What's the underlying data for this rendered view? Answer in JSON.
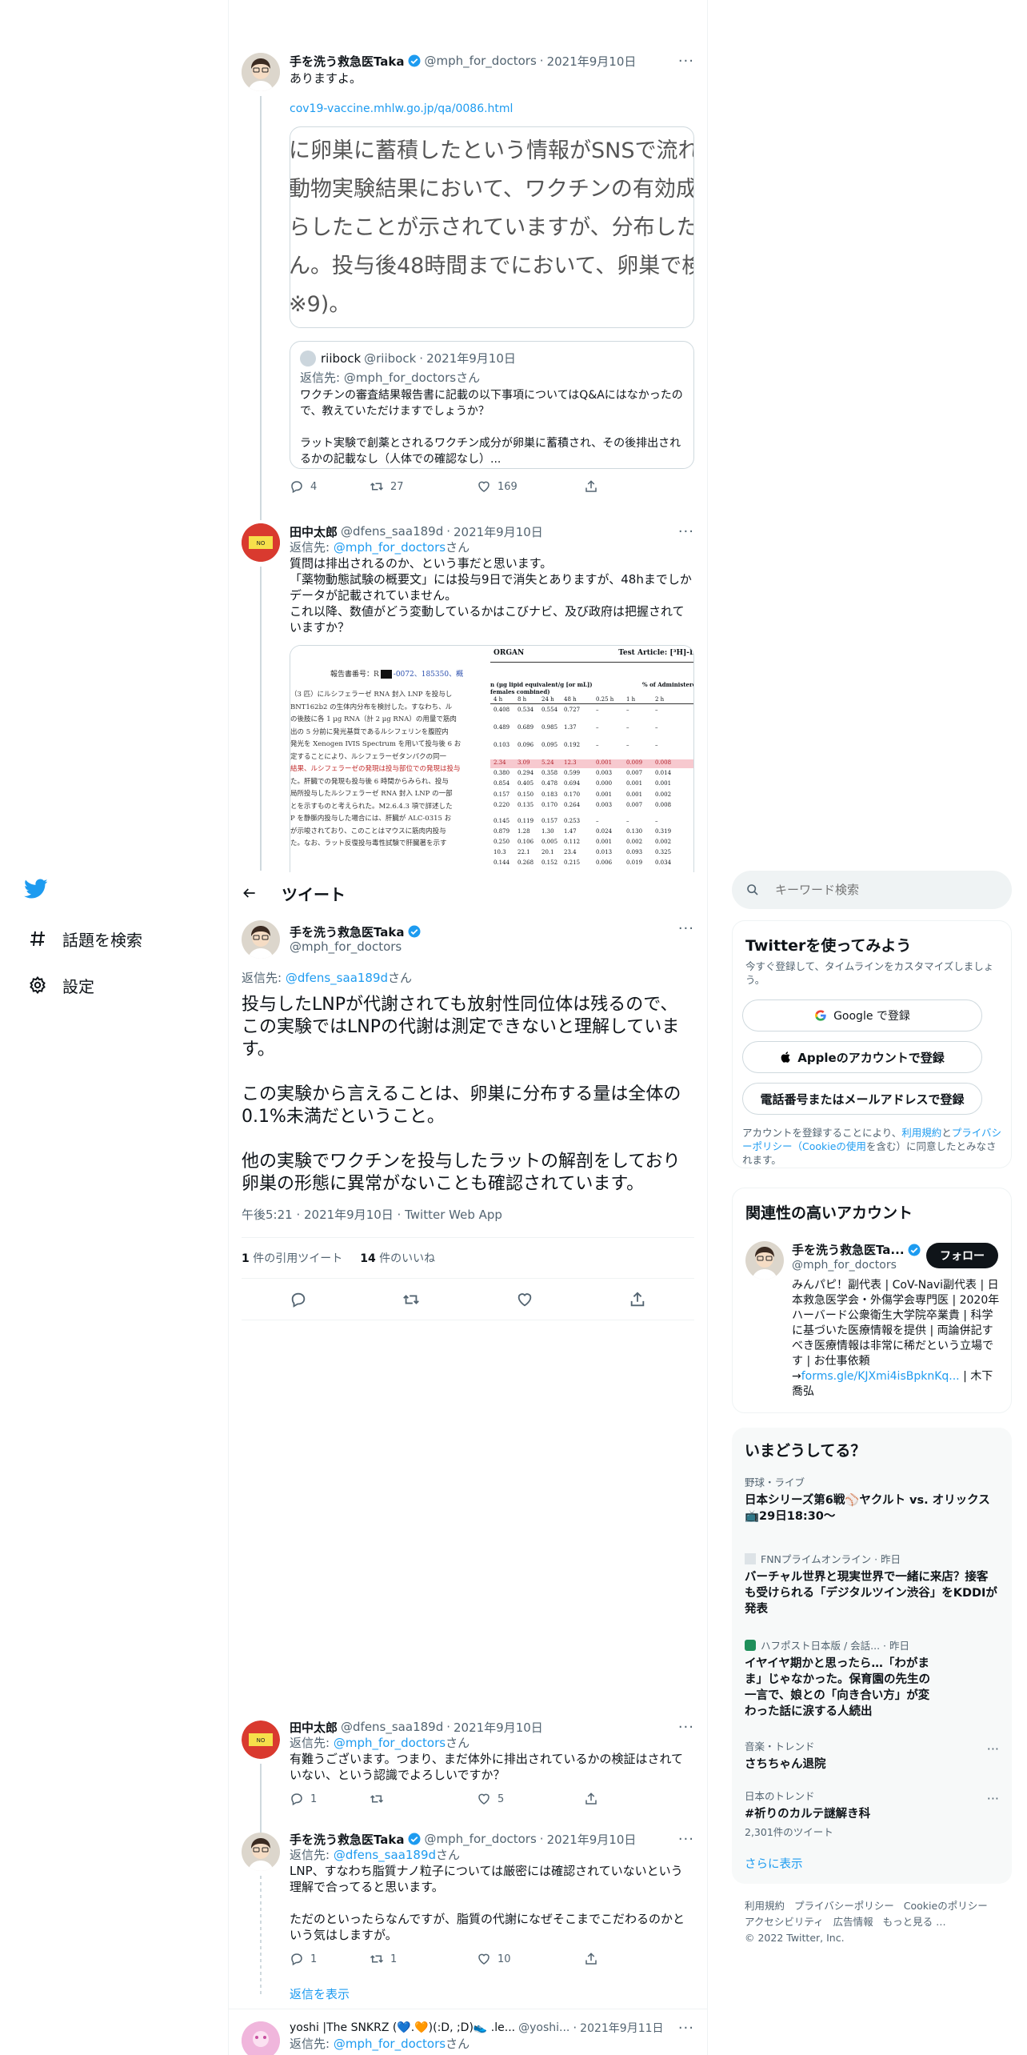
{
  "nav": {
    "explore": "話題を検索",
    "settings": "設定"
  },
  "header": {
    "title": "ツイート"
  },
  "tweet1": {
    "name": "手を洗う救急医Taka",
    "handle": "@mph_for_doctors",
    "dot": "·",
    "date": "2021年9月10日",
    "text": "ありますよ。",
    "link": "cov19-vaccine.mhlw.go.jp/qa/0086.html",
    "card_lines": [
      "に卵巣に蓄積したという情報がSNSで流れ",
      "動物実験結果において、ワクチンの有効成分",
      "らしたことが示されていますが、分布した量",
      "ん。投与後48時間までにおいて、卵巣で検出",
      "※9)。"
    ],
    "quote": {
      "name": "riibock",
      "handle": "@riibock",
      "dot": "·",
      "date": "2021年9月10日",
      "reply_prefix": "返信先: ",
      "reply_to": "@mph_for_doctors",
      "reply_suffix": "さん",
      "text": "ワクチンの審査結果報告書に記載の以下事項についてはQ&Aにはなかったので、教えていただけますでしょうか？\n\nラット実験で創薬とされるワクチン成分が卵巣に蓄積され、その後排出されるかの記載なし（人体での確認なし）..."
    },
    "replies": "4",
    "retweets": "27",
    "likes": "169"
  },
  "tweet2": {
    "name": "田中太郎",
    "handle": "@dfens_saa189d",
    "dot": "·",
    "date": "2021年9月10日",
    "reply_prefix": "返信先: ",
    "reply_to": "@mph_for_doctors",
    "reply_suffix": "さん",
    "text": "質問は排出されるのか、という事だと思います。\n「薬物動態試験の概要文」には投与9日で消失とありますが、48hまでしかデータが記載されていません。\nこれ以降、数値がどう変動しているかはこびナビ、及び政府は把握されていますか？",
    "image_left_header": "報告書番号：R",
    "image_left_header2": "-0072、185350、概",
    "image_left_lines": [
      "（3 匹）にルシフェラーゼ RNA 封入 LNP を投与し",
      "BNT162b2 の生体内分布を検討した。すなわち、ル",
      "の後肢に各 1 µg RNA（計 2 µg RNA）の用量で筋肉",
      "出の 5 分前に発光基質であるルシフェリンを腹腔内",
      "発光を Xenogen IVIS Spectrum を用いて投与後 6 お",
      "定することにより、ルシフェラーゼタンパクの同一",
      "結果、ルシフェラーゼの発現は投与部位での発現は投与",
      "た。肝臓での発現も投与後 6 時間からみられ、投与",
      "局所投与したルシフェラーゼ RNA 封入 LNP の一部",
      "とを示すものと考えられた。M2.6.4.3 項で詳述した",
      "P を静脈内投与した場合には、肝臓が ALC-0315 お",
      "が示唆されており、このことはマウスに筋肉内投与",
      "た。なお、ラット反復投与毒性試験で肝臓著を示す"
    ],
    "image_right_title": "ORGAN",
    "image_right_title2": "Test Article: [³H]-Labelled L",
    "image_right_sub": "n (µg lipid equivalent/g [or mL])",
    "image_right_sub2": "females combined)",
    "image_right_sub3": "% of Administered D",
    "image_right_cols": [
      "4 h",
      "8 h",
      "24 h",
      "48 h",
      "0.25 h",
      "1 h",
      "2 h"
    ],
    "image_right_rows": [
      [
        "0.408",
        "0.534",
        "0.554",
        "0.727",
        "–",
        "–",
        "–"
      ],
      [
        "0.489",
        "0.689",
        "0.985",
        "1.37",
        "–",
        "–",
        "–"
      ],
      [
        "0.103",
        "0.096",
        "0.095",
        "0.192",
        "–",
        "–",
        "–"
      ],
      [
        "2.34",
        "3.09",
        "5.24",
        "12.3",
        "0.001",
        "0.009",
        "0.008"
      ],
      [
        "0.380",
        "0.294",
        "0.358",
        "0.599",
        "0.003",
        "0.007",
        "0.014"
      ],
      [
        "0.854",
        "0.405",
        "0.478",
        "0.694",
        "0.000",
        "0.001",
        "0.001"
      ],
      [
        "0.157",
        "0.150",
        "0.183",
        "0.170",
        "0.001",
        "0.001",
        "0.002"
      ],
      [
        "0.220",
        "0.135",
        "0.170",
        "0.264",
        "0.003",
        "0.007",
        "0.008"
      ],
      [
        "0.145",
        "0.119",
        "0.157",
        "0.253",
        "–",
        "–",
        "–"
      ],
      [
        "0.879",
        "1.28",
        "1.30",
        "1.47",
        "0.024",
        "0.130",
        "0.319"
      ],
      [
        "0.250",
        "0.106",
        "0.005",
        "0.112",
        "0.001",
        "0.002",
        "0.002"
      ],
      [
        "10.3",
        "22.1",
        "20.1",
        "23.4",
        "0.013",
        "0.093",
        "0.325"
      ],
      [
        "0.144",
        "0.268",
        "0.152",
        "0.215",
        "0.006",
        "0.019",
        "0.034"
      ]
    ]
  },
  "main_tweet": {
    "name": "手を洗う救急医Taka",
    "handle": "@mph_for_doctors",
    "reply_prefix": "返信先: ",
    "reply_to": "@dfens_saa189d",
    "reply_suffix": "さん",
    "text": "投与したLNPが代謝されても放射性同位体は残るので、この実験ではLNPの代謝は測定できないと理解しています。\n\nこの実験から言えることは、卵巣に分布する量は全体の0.1%未満だということ。\n\n他の実験でワクチンを投与したラットの解剖をしており卵巣の形態に異常がないことも確認されています。",
    "time": "午後5:21 · 2021年9月10日 · Twitter Web App",
    "quote_count": "1",
    "quote_label": " 件の引用ツイート",
    "like_count": "14",
    "like_label": " 件のいいね"
  },
  "reply1": {
    "name": "田中太郎",
    "handle": "@dfens_saa189d",
    "dot": "·",
    "date": "2021年9月10日",
    "reply_prefix": "返信先: ",
    "reply_to": "@mph_for_doctors",
    "reply_suffix": "さん",
    "text": "有難うございます。つまり、まだ体外に排出されているかの検証はされていない、という認識でよろしいですか？",
    "replies": "1",
    "likes": "5"
  },
  "reply2": {
    "name": "手を洗う救急医Taka",
    "handle": "@mph_for_doctors",
    "dot": "·",
    "date": "2021年9月10日",
    "reply_prefix": "返信先: ",
    "reply_to": "@dfens_saa189d",
    "reply_suffix": "さん",
    "text": "LNP、すなわち脂質ナノ粒子については厳密には確認されていないという理解で合ってると思います。\n\nただのといったらなんですが、脂質の代謝になぜそこまでこだわるのかという気はしますが。",
    "replies": "1",
    "retweets": "1",
    "likes": "10"
  },
  "show_replies": "返信を表示",
  "reply3": {
    "name": "yoshi |The SNKRZ (💙.🧡)(:D, ;D)👟 .le...",
    "handle": "@yoshi...",
    "dot": "·",
    "date": "2021年9月11日",
    "reply_prefix": "返信先: ",
    "reply_to": "@mph_for_doctors",
    "reply_suffix": "さん"
  },
  "search": {
    "placeholder": "キーワード検索"
  },
  "signup": {
    "title": "Twitterを使ってみよう",
    "subtitle": "今すぐ登録して、タイムラインをカスタマイズしましょう。",
    "google": "Google で登録",
    "apple": "Appleのアカウントで登録",
    "phone": "電話番号またはメールアドレスで登録",
    "terms_pre": "アカウントを登録することにより、",
    "terms_link1": "利用規約",
    "terms_mid": "と",
    "terms_link2": "プライバシーポリシー（Cookieの使用",
    "terms_post": "を含む）に同意したとみなされます。"
  },
  "relevant": {
    "title": "関連性の高いアカウント",
    "name": "手を洗う救急医Ta...",
    "handle": "@mph_for_doctors",
    "follow": "フォロー",
    "bio": "みんパピ！副代表 | CoV-Navi副代表 | 日本救急医学会・外傷学会専門医 | 2020年ハーバード公衆衛生大学院卒業貴 | 科学に基づいた医療情報を提供 | 両論併記すべき医療情報は非常に稀だという立場です | お仕事依頼→",
    "bio_link": "forms.gle/KJXmi4isBpknKq...",
    "bio_post": " | 木下喬弘"
  },
  "trends": {
    "title": "いまどうしてる？",
    "items": [
      {
        "meta": "野球・ライブ",
        "title": "日本シリーズ第6戦⚾ヤクルト vs. オリックス📺29日18:30〜"
      },
      {
        "meta": "FNNプライムオンライン · 昨日",
        "title": "バーチャル世界と現実世界で一緒に来店？接客も受けられる「デジタルツイン渋谷」をKDDIが発表"
      },
      {
        "meta": "ハフポスト日本版 / 会話... · 昨日",
        "title": "イヤイヤ期かと思ったら…「わがまま」じゃなかった。保育園の先生の一言で、娘との「向き合い方」が変わった話に涙する人続出"
      },
      {
        "meta": "音楽・トレンド",
        "title": "さちちゃん退院"
      },
      {
        "meta": "日本のトレンド",
        "title": "#祈りのカルテ謎解き科",
        "count": "2,301件のツイート"
      }
    ],
    "more": "さらに表示"
  },
  "footer": {
    "links": [
      "利用規約",
      "プライバシーポリシー",
      "Cookieのポリシー",
      "アクセシビリティ",
      "広告情報",
      "もっと見る …",
      "© 2022 Twitter, Inc."
    ]
  },
  "colors": {
    "accent": "#1d9bf0",
    "text": "#0f1419",
    "muted": "#536471",
    "border": "#eff3f4"
  }
}
